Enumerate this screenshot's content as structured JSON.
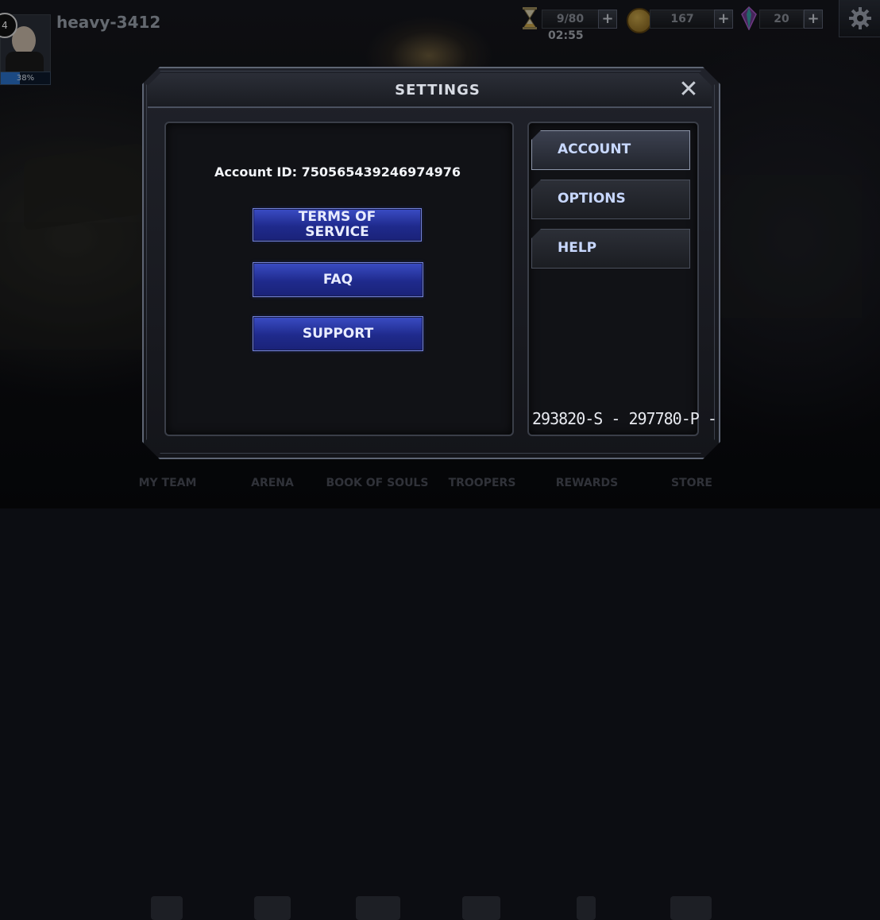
{
  "hud": {
    "level": "4",
    "username": "heavy-3412",
    "xp_percent": "38%",
    "xp_fraction": 0.38,
    "energy": "9/80",
    "energy_timer": "02:55",
    "coins": "167",
    "gems": "20",
    "plus_symbol": "+",
    "icons": [
      "hourglass-icon",
      "coin-icon",
      "gem-icon",
      "gear-icon"
    ]
  },
  "dialog": {
    "title": "SETTINGS",
    "close_symbol": "✕",
    "account_id": "Account ID: 750565439246974976",
    "buttons": {
      "terms": "TERMS OF SERVICE",
      "faq": "FAQ",
      "support": "SUPPORT"
    },
    "tabs": {
      "account": "ACCOUNT",
      "options": "OPTIONS",
      "help": "HELP"
    },
    "active_tab": "account",
    "version": "293820-S - 297780-P -"
  },
  "bottom_nav": {
    "my_team": "MY TEAM",
    "arena": "ARENA",
    "book_of_souls": "BOOK OF SOULS",
    "troopers": "TROOPERS",
    "rewards": "REWARDS",
    "store": "STORE"
  },
  "colors": {
    "accent_blue": "#2a3ab0",
    "tab_text": "#c8d8ff",
    "panel_border": "#5e6574"
  }
}
